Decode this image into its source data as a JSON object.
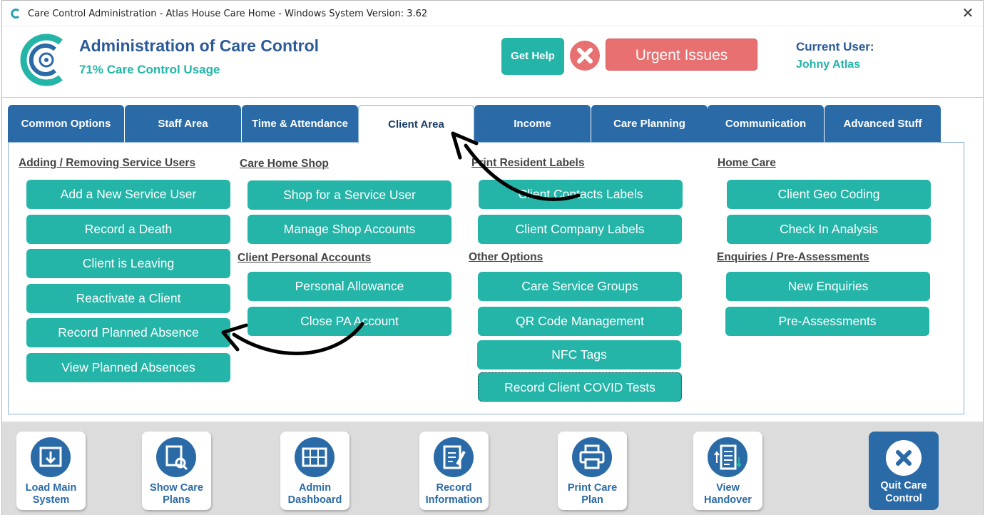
{
  "window": {
    "title": "Care Control Administration - Atlas House Care Home - Windows System Version: 3.62",
    "close_symbol": "✕"
  },
  "header": {
    "title": "Administration of Care Control",
    "usage": "71% Care Control Usage",
    "help_label": "Get Help",
    "urgent_label": "Urgent Issues",
    "current_user_label": "Current User:",
    "current_user_name": "Johny Atlas"
  },
  "tabs": [
    {
      "label": "Common Options"
    },
    {
      "label": "Staff Area"
    },
    {
      "label": "Time & Attendance"
    },
    {
      "label": "Client Area",
      "active": true
    },
    {
      "label": "Income"
    },
    {
      "label": "Care Planning"
    },
    {
      "label": "Communication"
    },
    {
      "label": "Advanced Stuff"
    }
  ],
  "sections": {
    "adding_removing": {
      "heading": "Adding / Removing Service Users",
      "buttons": [
        "Add a New Service User",
        "Record a Death",
        "Client is Leaving",
        "Reactivate a Client",
        "Record Planned Absence",
        "View Planned Absences"
      ]
    },
    "shop": {
      "heading": "Care Home Shop",
      "buttons": [
        "Shop for a Service User",
        "Manage Shop Accounts"
      ]
    },
    "personal_accounts": {
      "heading": "Client Personal Accounts",
      "buttons": [
        "Personal Allowance",
        "Close PA Account"
      ]
    },
    "labels": {
      "heading": "Print Resident Labels",
      "buttons": [
        "Client Contacts Labels",
        "Client Company Labels"
      ]
    },
    "other": {
      "heading": "Other Options",
      "buttons": [
        "Care Service Groups",
        "QR Code Management",
        "NFC Tags",
        "Record Client COVID Tests"
      ]
    },
    "home_care": {
      "heading": "Home Care",
      "buttons": [
        "Client Geo Coding",
        "Check In Analysis"
      ]
    },
    "enquiries": {
      "heading": "Enquiries / Pre-Assessments",
      "buttons": [
        "New Enquiries",
        "Pre-Assessments"
      ]
    }
  },
  "bottom_bar": [
    {
      "label": "Load Main\nSystem",
      "icon": "download-window-icon"
    },
    {
      "label": "Show Care\nPlans",
      "icon": "document-search-icon"
    },
    {
      "label": "Admin\nDashboard",
      "icon": "dashboard-grid-icon"
    },
    {
      "label": "Record\nInformation",
      "icon": "document-edit-icon"
    },
    {
      "label": "Print Care\nPlan",
      "icon": "printer-icon"
    },
    {
      "label": "View\nHandover",
      "icon": "checklist-icon"
    },
    {
      "label": "Quit Care\nControl",
      "icon": "close-circle-icon"
    }
  ],
  "colors": {
    "teal": "#24b4a8",
    "blue": "#2a6aa6",
    "title_blue": "#2b5a98",
    "urgent_red": "#e87070"
  }
}
